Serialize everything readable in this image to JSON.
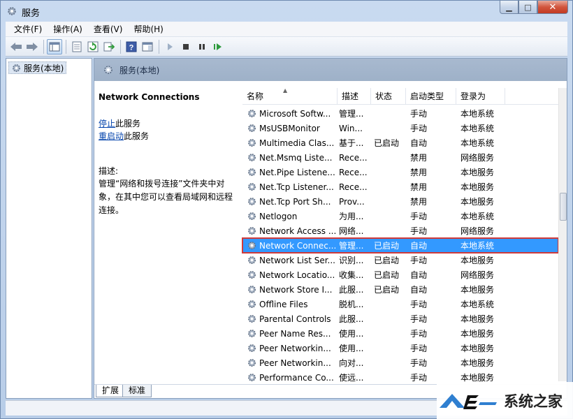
{
  "window": {
    "title": "服务"
  },
  "menu": [
    "文件(F)",
    "操作(A)",
    "查看(V)",
    "帮助(H)"
  ],
  "toolbar": [
    "back-icon",
    "forward-icon",
    "sep",
    "console-tree-icon",
    "sep",
    "properties-icon",
    "refresh-icon",
    "export-icon",
    "sep",
    "help-icon",
    "view-icon",
    "sep",
    "play-icon",
    "stop-icon",
    "pause-icon",
    "restart-icon"
  ],
  "tree": {
    "item": "服务(本地)"
  },
  "main": {
    "header": "服务(本地)",
    "detail": {
      "title": "Network Connections",
      "stop_link": "停止",
      "stop_suffix": "此服务",
      "restart_link": "重启动",
      "restart_suffix": "此服务",
      "desc_label": "描述:",
      "desc": "管理“网络和拨号连接”文件夹中对象，在其中您可以查看局域网和远程连接。"
    },
    "columns": [
      "名称",
      "描述",
      "状态",
      "启动类型",
      "登录为"
    ],
    "rows": [
      {
        "name": "Microsoft Softw...",
        "desc": "管理...",
        "status": "",
        "type": "手动",
        "logon": "本地系统"
      },
      {
        "name": "MsUSBMonitor",
        "desc": "Win...",
        "status": "",
        "type": "手动",
        "logon": "本地系统"
      },
      {
        "name": "Multimedia Clas...",
        "desc": "基于...",
        "status": "已启动",
        "type": "自动",
        "logon": "本地系统"
      },
      {
        "name": "Net.Msmq Liste...",
        "desc": "Rece...",
        "status": "",
        "type": "禁用",
        "logon": "网络服务"
      },
      {
        "name": "Net.Pipe Listene...",
        "desc": "Rece...",
        "status": "",
        "type": "禁用",
        "logon": "本地服务"
      },
      {
        "name": "Net.Tcp Listener...",
        "desc": "Rece...",
        "status": "",
        "type": "禁用",
        "logon": "本地服务"
      },
      {
        "name": "Net.Tcp Port Sh...",
        "desc": "Prov...",
        "status": "",
        "type": "禁用",
        "logon": "本地服务"
      },
      {
        "name": "Netlogon",
        "desc": "为用...",
        "status": "",
        "type": "手动",
        "logon": "本地系统"
      },
      {
        "name": "Network Access ...",
        "desc": "网络...",
        "status": "",
        "type": "手动",
        "logon": "网络服务"
      },
      {
        "name": "Network Connec...",
        "desc": "管理...",
        "status": "已启动",
        "type": "自动",
        "logon": "本地系统",
        "selected": true
      },
      {
        "name": "Network List Ser...",
        "desc": "识别...",
        "status": "已启动",
        "type": "手动",
        "logon": "本地服务"
      },
      {
        "name": "Network Locatio...",
        "desc": "收集...",
        "status": "已启动",
        "type": "自动",
        "logon": "网络服务"
      },
      {
        "name": "Network Store I...",
        "desc": "此服...",
        "status": "已启动",
        "type": "自动",
        "logon": "本地服务"
      },
      {
        "name": "Offline Files",
        "desc": "脱机...",
        "status": "",
        "type": "手动",
        "logon": "本地系统"
      },
      {
        "name": "Parental Controls",
        "desc": "此服...",
        "status": "",
        "type": "手动",
        "logon": "本地服务"
      },
      {
        "name": "Peer Name Res...",
        "desc": "使用...",
        "status": "",
        "type": "手动",
        "logon": "本地服务"
      },
      {
        "name": "Peer Networkin...",
        "desc": "使用...",
        "status": "",
        "type": "手动",
        "logon": "本地服务"
      },
      {
        "name": "Peer Networkin...",
        "desc": "向对...",
        "status": "",
        "type": "手动",
        "logon": "本地服务"
      },
      {
        "name": "Performance Co...",
        "desc": "使远...",
        "status": "",
        "type": "手动",
        "logon": "本地服务"
      }
    ]
  },
  "tabs": [
    "扩展",
    "标准"
  ],
  "watermark": "系统之家",
  "colors": {
    "selection": "#3399ff",
    "highlight_border": "#d03a3a",
    "header": "#a8b9cf"
  }
}
